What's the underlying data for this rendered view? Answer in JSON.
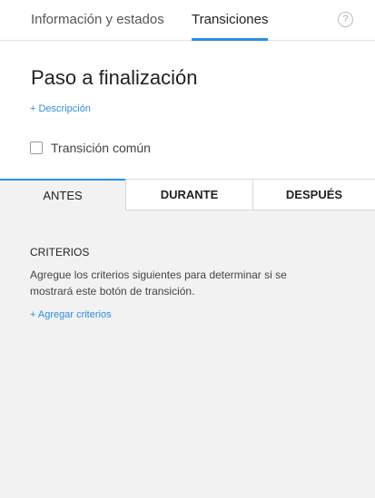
{
  "header": {
    "tabs": [
      {
        "label": "Información y estados"
      },
      {
        "label": "Transiciones"
      }
    ],
    "help_symbol": "?"
  },
  "transition": {
    "title": "Paso a finalización",
    "description_link": "+ Descripción",
    "common_label": "Transición común"
  },
  "phases": [
    {
      "label": "ANTES"
    },
    {
      "label": "DURANTE"
    },
    {
      "label": "DESPUÉS"
    }
  ],
  "criteria": {
    "title": "CRITERIOS",
    "text": "Agregue los criterios siguientes para determinar si se mostrará este botón de transición.",
    "add_link": "+ Agregar criterios"
  },
  "colors": {
    "accent": "#2d8ee0",
    "panel_bg": "#f2f2f2"
  },
  "icons": {
    "help": "help-circle-icon",
    "checkbox": "checkbox-unchecked-icon"
  }
}
